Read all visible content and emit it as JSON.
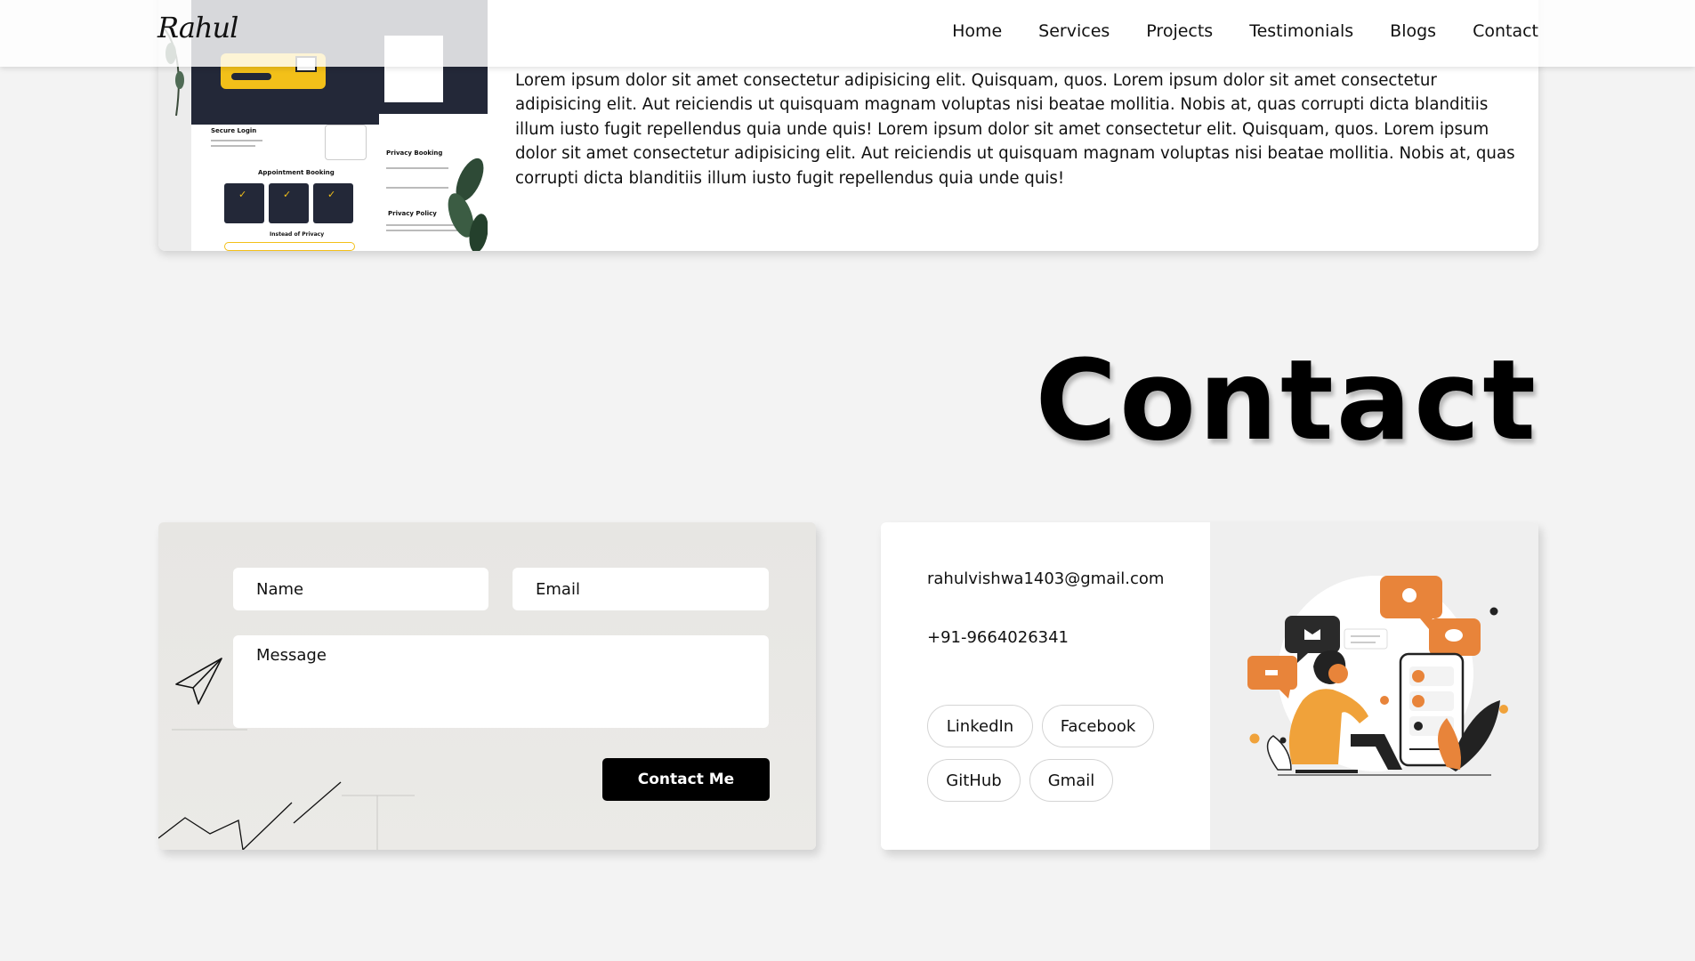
{
  "nav": {
    "logo": "Rahul",
    "links": [
      "Home",
      "Services",
      "Projects",
      "Testimonials",
      "Blogs",
      "Contact"
    ]
  },
  "project": {
    "screenshot_texts": [
      "Secure Login",
      "Appointment Booking",
      "Privacy Booking",
      "Privacy Policy",
      "Instead of Privacy"
    ],
    "description": "Lorem ipsum dolor sit amet consectetur adipisicing elit. Quisquam, quos. Lorem ipsum dolor sit amet consectetur adipisicing elit. Aut reiciendis ut quisquam magnam voluptas nisi beatae mollitia. Nobis at, quas corrupti dicta blanditiis illum iusto fugit repellendus quia unde quis! Lorem ipsum dolor sit amet consectetur elit. Quisquam, quos. Lorem ipsum dolor sit amet consectetur adipisicing elit. Aut reiciendis ut quisquam magnam voluptas nisi beatae mollitia. Nobis at, quas corrupti dicta blanditiis illum iusto fugit repellendus quia unde quis!"
  },
  "contact": {
    "title": "Contact",
    "form": {
      "name_placeholder": "Name",
      "email_placeholder": "Email",
      "message_placeholder": "Message",
      "submit_label": "Contact Me"
    },
    "info": {
      "email": "rahulvishwa1403@gmail.com",
      "phone": "+91-9664026341",
      "socials": [
        "LinkedIn",
        "Facebook",
        "GitHub",
        "Gmail"
      ]
    }
  },
  "colors": {
    "accent_yellow": "#f3c019",
    "dark_navy": "#232838",
    "illustration_orange": "#e8843a",
    "page_background": "#f3f3f3"
  }
}
